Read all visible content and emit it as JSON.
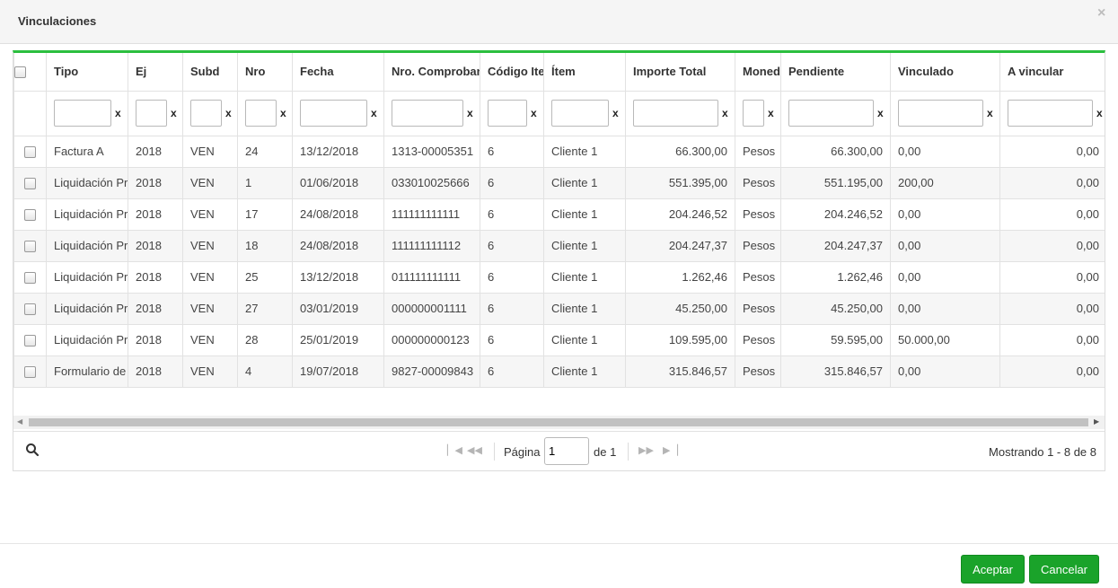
{
  "dialog": {
    "title": "Vinculaciones",
    "close_glyph": "×"
  },
  "table": {
    "columns": [
      "Tipo",
      "Ej",
      "Subd",
      "Nro",
      "Fecha",
      "Nro. Comprobante",
      "Código Item",
      "Ítem",
      "Importe Total",
      "Moneda",
      "Pendiente",
      "Vinculado",
      "A vincular"
    ],
    "filter_clear": "x",
    "rows": [
      [
        "Factura A",
        "2018",
        "VEN",
        "24",
        "13/12/2018",
        "1313-00005351",
        "6",
        "Cliente 1",
        "66.300,00",
        "Pesos",
        "66.300,00",
        "0,00",
        "0,00"
      ],
      [
        "Liquidación Pr",
        "2018",
        "VEN",
        "1",
        "01/06/2018",
        "033010025666",
        "6",
        "Cliente 1",
        "551.395,00",
        "Pesos",
        "551.195,00",
        "200,00",
        "0,00"
      ],
      [
        "Liquidación Pr",
        "2018",
        "VEN",
        "17",
        "24/08/2018",
        "111111111111",
        "6",
        "Cliente 1",
        "204.246,52",
        "Pesos",
        "204.246,52",
        "0,00",
        "0,00"
      ],
      [
        "Liquidación Pr",
        "2018",
        "VEN",
        "18",
        "24/08/2018",
        "111111111112",
        "6",
        "Cliente 1",
        "204.247,37",
        "Pesos",
        "204.247,37",
        "0,00",
        "0,00"
      ],
      [
        "Liquidación Pr",
        "2018",
        "VEN",
        "25",
        "13/12/2018",
        "011111111111",
        "6",
        "Cliente 1",
        "1.262,46",
        "Pesos",
        "1.262,46",
        "0,00",
        "0,00"
      ],
      [
        "Liquidación Pr",
        "2018",
        "VEN",
        "27",
        "03/01/2019",
        "000000001111",
        "6",
        "Cliente 1",
        "45.250,00",
        "Pesos",
        "45.250,00",
        "0,00",
        "0,00"
      ],
      [
        "Liquidación Pr",
        "2018",
        "VEN",
        "28",
        "25/01/2019",
        "000000000123",
        "6",
        "Cliente 1",
        "109.595,00",
        "Pesos",
        "59.595,00",
        "50.000,00",
        "0,00"
      ],
      [
        "Formulario de",
        "2018",
        "VEN",
        "4",
        "19/07/2018",
        "9827-00009843",
        "6",
        "Cliente 1",
        "315.846,57",
        "Pesos",
        "315.846,57",
        "0,00",
        "0,00"
      ]
    ]
  },
  "pager": {
    "page_label": "Página",
    "page_value": "1",
    "of_label": "de 1",
    "showing": "Mostrando 1 - 8 de 8"
  },
  "footer": {
    "accept": "Aceptar",
    "cancel": "Cancelar"
  },
  "icons": {
    "search": "search-icon",
    "first": "first-page-icon",
    "prev": "prev-page-icon",
    "next": "next-page-icon",
    "last": "last-page-icon",
    "close": "close-icon"
  },
  "colors": {
    "accent_green": "#1aa32a",
    "grid_top_border": "#2bbf3f"
  }
}
